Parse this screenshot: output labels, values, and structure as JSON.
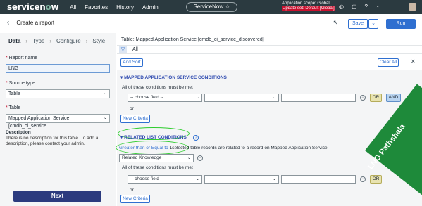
{
  "topnav": {
    "logo_main": "servicen",
    "logo_o": "o",
    "logo_end": "w",
    "links": [
      "All",
      "Favorites",
      "History",
      "Admin"
    ],
    "chip": "ServiceNow ☆",
    "scope_line": "Application scope: Global",
    "update_set": "Update set: Default [Global]"
  },
  "header": {
    "title": "Create a report",
    "save_label": "Save",
    "run_label": "Run"
  },
  "left": {
    "tabs": [
      "Data",
      "Type",
      "Configure",
      "Style"
    ],
    "report_name_label": "Report name",
    "report_name_value": "LNG",
    "source_type_label": "Source type",
    "source_type_value": "Table",
    "table_label": "Table",
    "table_value": "Mapped Application Service [cmdb_ci_service...",
    "description_heading": "Description",
    "description_text": "There is no description for this table. To add a description, please contact your admin.",
    "next_label": "Next"
  },
  "right": {
    "table_title": "Table: Mapped Application Service [cmdb_ci_service_discovered]",
    "filter_all": "All",
    "add_sort": "Add Sort",
    "clear_all": "Clear All",
    "section1": "MAPPED APPLICATION SERVICE CONDITIONS",
    "all_conditions1": "All of these conditions must be met",
    "choose_field1": "-- choose field --",
    "or_btn": "OR",
    "and_btn": "AND",
    "or_text1": "or",
    "new_criteria1": "New Criteria",
    "section2": "RELATED LIST CONDITIONS",
    "related_link": "Greater than or Equal to",
    "related_value": "1",
    "related_text": "selected table records are related to a record on Mapped Application Service",
    "related_select": "Related Knowledge",
    "all_conditions2": "All of these conditions must be met",
    "choose_field2": "-- choose field --",
    "or_text2": "or",
    "new_criteria2": "New Criteria"
  },
  "watermark": "LNG Pathshala"
}
